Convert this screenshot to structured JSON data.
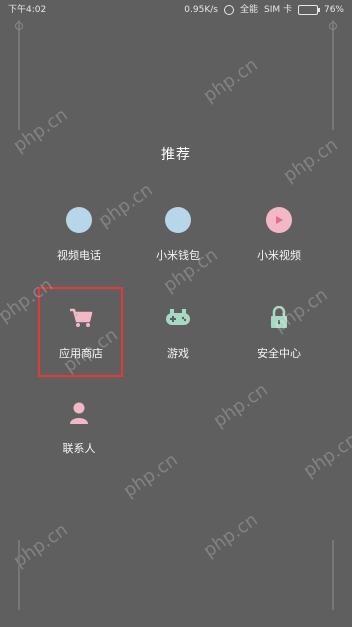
{
  "status_bar": {
    "time": "下午4:02",
    "network_speed": "0.95K/s",
    "carrier": "SIM 卡",
    "battery": "76%",
    "extra": "全能"
  },
  "section_title": "推荐",
  "grid": [
    {
      "label": "视频电话",
      "icon": "video-call-icon"
    },
    {
      "label": "小米钱包",
      "icon": "wallet-icon"
    },
    {
      "label": "小米视频",
      "icon": "play-icon"
    },
    {
      "label": "应用商店",
      "icon": "cart-icon"
    },
    {
      "label": "游戏",
      "icon": "gamepad-icon"
    },
    {
      "label": "安全中心",
      "icon": "lock-icon"
    },
    {
      "label": "联系人",
      "icon": "person-icon"
    }
  ],
  "watermark_text": "php.cn",
  "colors": {
    "background": "#5f5f5f",
    "highlight": "#e23a3a",
    "light_blue": "#b7d6ea",
    "pink": "#f1b9c6",
    "mint": "#a8d9c4"
  }
}
